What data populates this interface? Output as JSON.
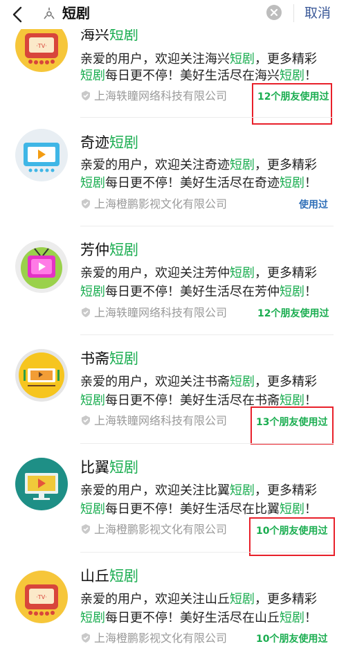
{
  "search": {
    "query": "短剧",
    "cancel_label": "取消"
  },
  "results": [
    {
      "name_prefix": "海兴",
      "name_highlight": "短剧",
      "desc_line1": [
        "亲爱的用户，欢迎关注海兴",
        "短剧",
        "，更多精彩"
      ],
      "desc_line2": [
        "短剧",
        "每日更不停！美好生活尽在海兴",
        "短剧",
        "！"
      ],
      "company": "上海轶瞳网络科技有限公司",
      "badge": "12个朋友使用过",
      "badge_color": "#1aad50",
      "avatar_icon": "retro-tv-icon"
    },
    {
      "name_prefix": "奇迹",
      "name_highlight": "短剧",
      "desc_line1": [
        "亲爱的用户，欢迎关注奇迹",
        "短剧",
        "，更多精彩"
      ],
      "desc_line2": [
        "短剧",
        "每日更不停！美好生活尽在奇迹",
        "短剧",
        "！"
      ],
      "company": "上海橙鹏影视文化有限公司",
      "badge": "使用过",
      "badge_color": "#2f6fb8",
      "avatar_icon": "blue-tv-icon"
    },
    {
      "name_prefix": "芳仲",
      "name_highlight": "短剧",
      "desc_line1": [
        "亲爱的用户，欢迎关注芳仲",
        "短剧",
        "，更多精彩"
      ],
      "desc_line2": [
        "短剧",
        "每日更不停！美好生活尽在芳仲",
        "短剧",
        "！"
      ],
      "company": "上海轶瞳网络科技有限公司",
      "badge": "12个朋友使用过",
      "badge_color": "#1aad50",
      "avatar_icon": "magenta-tv-icon"
    },
    {
      "name_prefix": "书斋",
      "name_highlight": "短剧",
      "desc_line1": [
        "亲爱的用户，欢迎关注书斋",
        "短剧",
        "，更多精彩"
      ],
      "desc_line2": [
        "短剧",
        "每日更不停！美好生活尽在书斋",
        "短剧",
        "！"
      ],
      "company": "上海轶瞳网络科技有限公司",
      "badge": "13个朋友使用过",
      "badge_color": "#1aad50",
      "avatar_icon": "yellow-screen-icon"
    },
    {
      "name_prefix": "比翼",
      "name_highlight": "短剧",
      "desc_line1": [
        "亲爱的用户，欢迎关注比翼",
        "短剧",
        "，更多精彩"
      ],
      "desc_line2": [
        "短剧",
        "每日更不停！美好生活尽在比翼",
        "短剧",
        "！"
      ],
      "company": "上海橙鹏影视文化有限公司",
      "badge": "10个朋友使用过",
      "badge_color": "#1aad50",
      "avatar_icon": "teal-monitor-icon"
    },
    {
      "name_prefix": "山丘",
      "name_highlight": "短剧",
      "desc_line1": [
        "亲爱的用户，欢迎关注山丘",
        "短剧",
        "，更多精彩"
      ],
      "desc_line2": [
        "短剧",
        "每日更不停！美好生活尽在山丘",
        "短剧",
        "！"
      ],
      "company": "上海橙鹏影视文化有限公司",
      "badge": "10个朋友使用过",
      "badge_color": "#1aad50",
      "avatar_icon": "retro-tv-icon"
    }
  ]
}
